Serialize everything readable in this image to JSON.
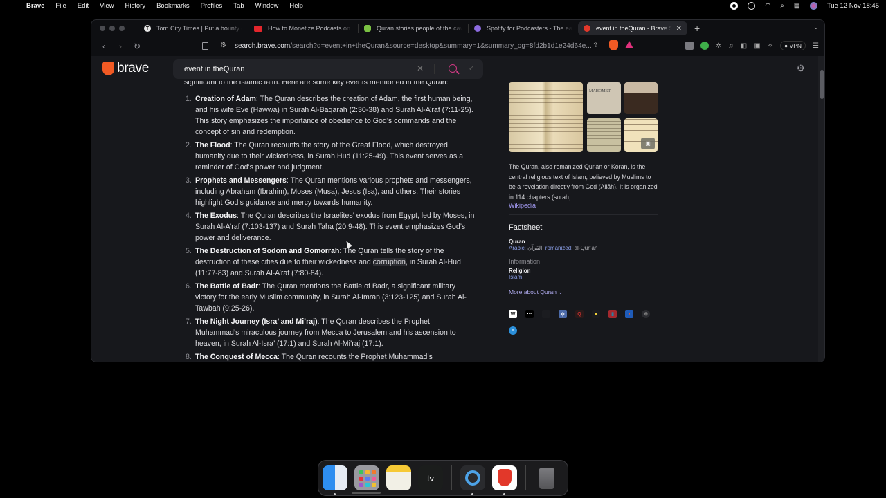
{
  "menubar": {
    "app": "Brave",
    "items": [
      "File",
      "Edit",
      "View",
      "History",
      "Bookmarks",
      "Profiles",
      "Tab",
      "Window",
      "Help"
    ],
    "datetime": "Tue 12 Nov  18:45"
  },
  "tabs": [
    {
      "label": "Torn City Times | Put a bounty on",
      "icon": "torn-icon",
      "color": "#e8e8e8",
      "active": false
    },
    {
      "label": "How to Monetize Podcasts on Sp",
      "icon": "youtube-icon",
      "color": "#e3262c",
      "active": false
    },
    {
      "label": "Quran stories people of the cave",
      "icon": "rumble-icon",
      "color": "#7ac143",
      "active": false
    },
    {
      "label": "Spotify for Podcasters - The easi",
      "icon": "spotify-podcasters-icon",
      "color": "#8c6be0",
      "active": false
    },
    {
      "label": "event in theQuran - Brave Se",
      "icon": "brave-search-icon",
      "color": "#e2382a",
      "active": true
    }
  ],
  "toolbar": {
    "url_host": "search.brave.com",
    "url_rest": "/search?q=event+in+theQuran&source=desktop&summary=1&summary_og=8fd2b1d1e24d64e...",
    "shields_count": "1",
    "vpn_label": "VPN"
  },
  "search": {
    "logo_text": "brave",
    "query": "event in theQuran"
  },
  "summary": {
    "intro": "significant to the Islamic faith. Here are some key events mentioned in the Quran:",
    "items": [
      {
        "num": "1.",
        "title": "Creation of Adam",
        "text": ": The Quran describes the creation of Adam, the first human being, and his wife Eve (Hawwa) in Surah Al-Baqarah (2:30-38) and Surah Al-A’raf (7:11-25). This story emphasizes the importance of obedience to God’s commands and the concept of sin and redemption."
      },
      {
        "num": "2.",
        "title": "The Flood",
        "text": ": The Quran recounts the story of the Great Flood, which destroyed humanity due to their wickedness, in Surah Hud (11:25-49). This event serves as a reminder of God's power and judgment."
      },
      {
        "num": "3.",
        "title": "Prophets and Messengers",
        "text": ": The Quran mentions various prophets and messengers, including Abraham (Ibrahim), Moses (Musa), Jesus (Isa), and others. Their stories highlight God’s guidance and mercy towards humanity."
      },
      {
        "num": "4.",
        "title": "The Exodus",
        "text": ": The Quran describes the Israelites’ exodus from Egypt, led by Moses, in Surah Al-A’raf (7:103-137) and Surah Taha (20:9-48). This event emphasizes God’s power and deliverance."
      },
      {
        "num": "5.",
        "title": "The Destruction of Sodom and Gomorrah",
        "text_before": ": The Quran tells the story of the destruction of these cities due to their wickedness and ",
        "highlight": "corruption",
        "text_after": ", in Surah Al-Hud (11:77-83) and Surah Al-A’raf (7:80-84)."
      },
      {
        "num": "6.",
        "title": "The Battle of Badr",
        "text": ": The Quran mentions the Battle of Badr, a significant military victory for the early Muslim community, in Surah Al-Imran (3:123-125) and Surah Al-Tawbah (9:25-26)."
      },
      {
        "num": "7.",
        "title": "The Night Journey (Isra’ and Mi’raj)",
        "text": ": The Quran describes the Prophet Muhammad’s miraculous journey from Mecca to Jerusalem and his ascension to heaven, in Surah Al-Isra’ (17:1) and Surah Al-Mi’raj (17:1)."
      },
      {
        "num": "8.",
        "title": "The Conquest of Mecca",
        "text": ": The Quran recounts the Prophet Muhammad’s"
      }
    ]
  },
  "knowledge_panel": {
    "description": "The Quran, also romanized Qur'an or Koran, is the central religious text of Islam, believed by Muslims to be a revelation directly from God (Allāh). It is organized in 114 chapters (surah, ...",
    "source_link": "Wikipedia",
    "factsheet_title": "Factsheet",
    "name_label": "Quran",
    "arabic_label": "Arabic: ",
    "arabic_value": "القرآن",
    "romanized_label": ", romanized: ",
    "romanized_value": "al-Qurʾān",
    "information_label": "Information",
    "religion_label": "Religion",
    "religion_value": "Islam",
    "more_label": "More about Quran",
    "links": [
      {
        "icon": "wikipedia-icon",
        "bg": "#ffffff",
        "fg": "#111",
        "glyph": "W"
      },
      {
        "icon": "esc-icon",
        "bg": "#000000",
        "fg": "#fff",
        "glyph": "···"
      },
      {
        "icon": "dark-site-icon",
        "bg": "#1b1c20",
        "fg": "#444",
        "glyph": ""
      },
      {
        "icon": "britannica-icon",
        "bg": "#4c6aa8",
        "fg": "#fff",
        "glyph": "ψ"
      },
      {
        "icon": "quora-icon",
        "bg": "#2a1a1a",
        "fg": "#c8312f",
        "glyph": "Q"
      },
      {
        "icon": "yellow-site-icon",
        "bg": "#1b1c20",
        "fg": "#f2d23a",
        "glyph": "●"
      },
      {
        "icon": "library-icon",
        "bg": "#a3282e",
        "fg": "#2a7fa0",
        "glyph": "▮"
      },
      {
        "icon": "blue-site-icon",
        "bg": "#1f5bb8",
        "fg": "#f05a28",
        "glyph": "▪"
      },
      {
        "icon": "globe-icon",
        "bg": "#2a2b30",
        "fg": "#888",
        "glyph": "⊕"
      },
      {
        "icon": "circle-site-icon",
        "bg": "#2b8fd9",
        "fg": "#fff",
        "glyph": "≡"
      }
    ]
  },
  "dock": {
    "apps": [
      "Finder",
      "Launchpad",
      "Notes",
      "Apple TV",
      "QuickTime Player",
      "Brave Browser",
      "Trash"
    ],
    "tv_label": "tv"
  }
}
